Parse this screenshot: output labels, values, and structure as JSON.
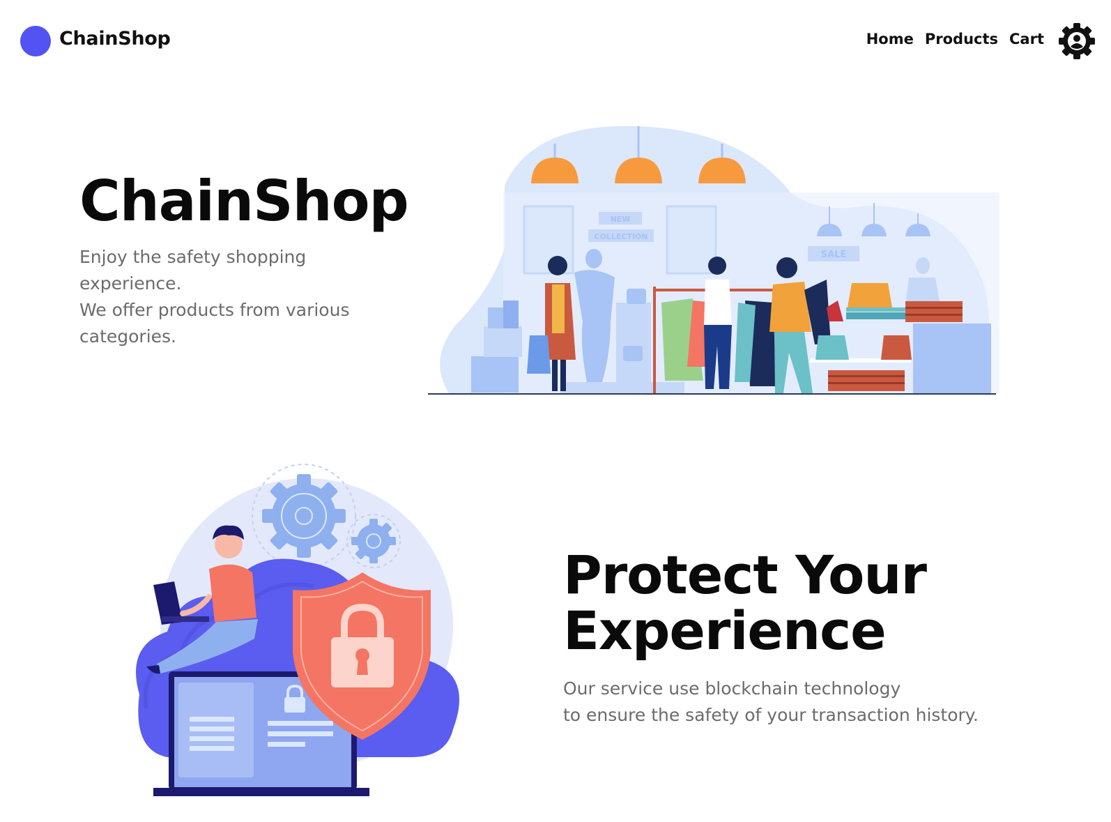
{
  "brand": {
    "name": "ChainShop",
    "logo_color": "#5352f3"
  },
  "nav": {
    "home": "Home",
    "products": "Products",
    "cart": "Cart",
    "settings_icon": "gear-icon"
  },
  "hero": {
    "title": "ChainShop",
    "subtitle_line1": "Enjoy the safety shopping experience.",
    "subtitle_line2": "We offer products from various categories."
  },
  "shop_illustration": {
    "sign_new": "NEW",
    "sign_collection": "COLLECTION",
    "sign_sale": "SALE"
  },
  "security": {
    "title_line1": "Protect Your",
    "title_line2": "Experience",
    "subtitle_line1": "Our service use blockchain technology",
    "subtitle_line2": "to ensure the safety of your transaction history."
  },
  "colors": {
    "accent": "#5352f3",
    "shield": "#f47563",
    "lamp": "#f79a3e",
    "pale_blue": "#dbe7fb",
    "mid_blue": "#a8c3f5",
    "text_muted": "#6b6b6b"
  }
}
